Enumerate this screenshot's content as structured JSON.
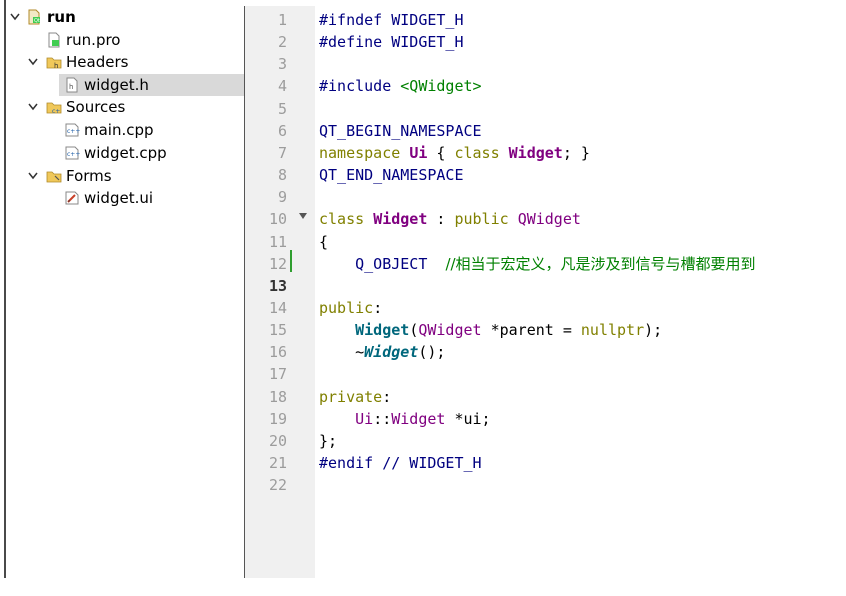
{
  "project_tree": {
    "root": {
      "label": "run",
      "expanded": true
    },
    "items": [
      {
        "label": "run.pro",
        "type": "pro-file"
      },
      {
        "label": "Headers",
        "type": "folder",
        "expanded": true
      },
      {
        "label": "widget.h",
        "type": "header-file",
        "selected": true
      },
      {
        "label": "Sources",
        "type": "folder",
        "expanded": true
      },
      {
        "label": "main.cpp",
        "type": "cpp-file"
      },
      {
        "label": "widget.cpp",
        "type": "cpp-file"
      },
      {
        "label": "Forms",
        "type": "folder",
        "expanded": true
      },
      {
        "label": "widget.ui",
        "type": "ui-file"
      }
    ]
  },
  "editor": {
    "current_line": "13",
    "line_numbers": [
      "1",
      "2",
      "3",
      "4",
      "5",
      "6",
      "7",
      "8",
      "9",
      "10",
      "11",
      "12",
      "13",
      "14",
      "15",
      "16",
      "17",
      "18",
      "19",
      "20",
      "21",
      "22"
    ],
    "lines": [
      [
        {
          "t": "#ifndef WIDGET_H",
          "c": "pp"
        }
      ],
      [
        {
          "t": "#define WIDGET_H",
          "c": "pp"
        }
      ],
      [],
      [
        {
          "t": "#include ",
          "c": "pp"
        },
        {
          "t": "<QWidget>",
          "c": "inc"
        }
      ],
      [],
      [
        {
          "t": "QT_BEGIN_NAMESPACE",
          "c": "mac"
        }
      ],
      [
        {
          "t": "namespace",
          "c": "kw"
        },
        {
          "t": " "
        },
        {
          "t": "Ui",
          "c": "ty"
        },
        {
          "t": " { "
        },
        {
          "t": "class",
          "c": "kw"
        },
        {
          "t": " "
        },
        {
          "t": "Widget",
          "c": "ty"
        },
        {
          "t": "; }"
        }
      ],
      [
        {
          "t": "QT_END_NAMESPACE",
          "c": "mac"
        }
      ],
      [],
      [
        {
          "t": "class",
          "c": "kw"
        },
        {
          "t": " "
        },
        {
          "t": "Widget",
          "c": "ty"
        },
        {
          "t": " : "
        },
        {
          "t": "public",
          "c": "kw"
        },
        {
          "t": " "
        },
        {
          "t": "QWidget",
          "c": "ty2"
        }
      ],
      [
        {
          "t": "{"
        }
      ],
      [
        {
          "t": "    "
        },
        {
          "t": "Q_OBJECT",
          "c": "mac"
        },
        {
          "t": "  "
        },
        {
          "t": "//相当于宏定义，凡是涉及到信号与槽都要用到",
          "c": "cm"
        }
      ],
      [],
      [
        {
          "t": "public",
          "c": "kw"
        },
        {
          "t": ":"
        }
      ],
      [
        {
          "t": "    "
        },
        {
          "t": "Widget",
          "c": "fn"
        },
        {
          "t": "("
        },
        {
          "t": "QWidget",
          "c": "ty2"
        },
        {
          "t": " *parent = "
        },
        {
          "t": "nullptr",
          "c": "kw"
        },
        {
          "t": ");"
        }
      ],
      [
        {
          "t": "    ~"
        },
        {
          "t": "Widget",
          "c": "fni"
        },
        {
          "t": "();"
        }
      ],
      [],
      [
        {
          "t": "private",
          "c": "kw"
        },
        {
          "t": ":"
        }
      ],
      [
        {
          "t": "    "
        },
        {
          "t": "Ui",
          "c": "ty2"
        },
        {
          "t": "::"
        },
        {
          "t": "Widget",
          "c": "ty2"
        },
        {
          "t": " *ui;"
        }
      ],
      [
        {
          "t": "};"
        }
      ],
      [
        {
          "t": "#endif",
          "c": "pp"
        },
        {
          "t": " // WIDGET_H",
          "c": "pp"
        }
      ],
      []
    ]
  },
  "colors": {
    "selection": "#d9d9d9",
    "gutter": "#f0f0f0",
    "keyword": "#808000",
    "type": "#800080",
    "function": "#00677c",
    "comment": "#008000",
    "preprocessor": "#000080"
  }
}
